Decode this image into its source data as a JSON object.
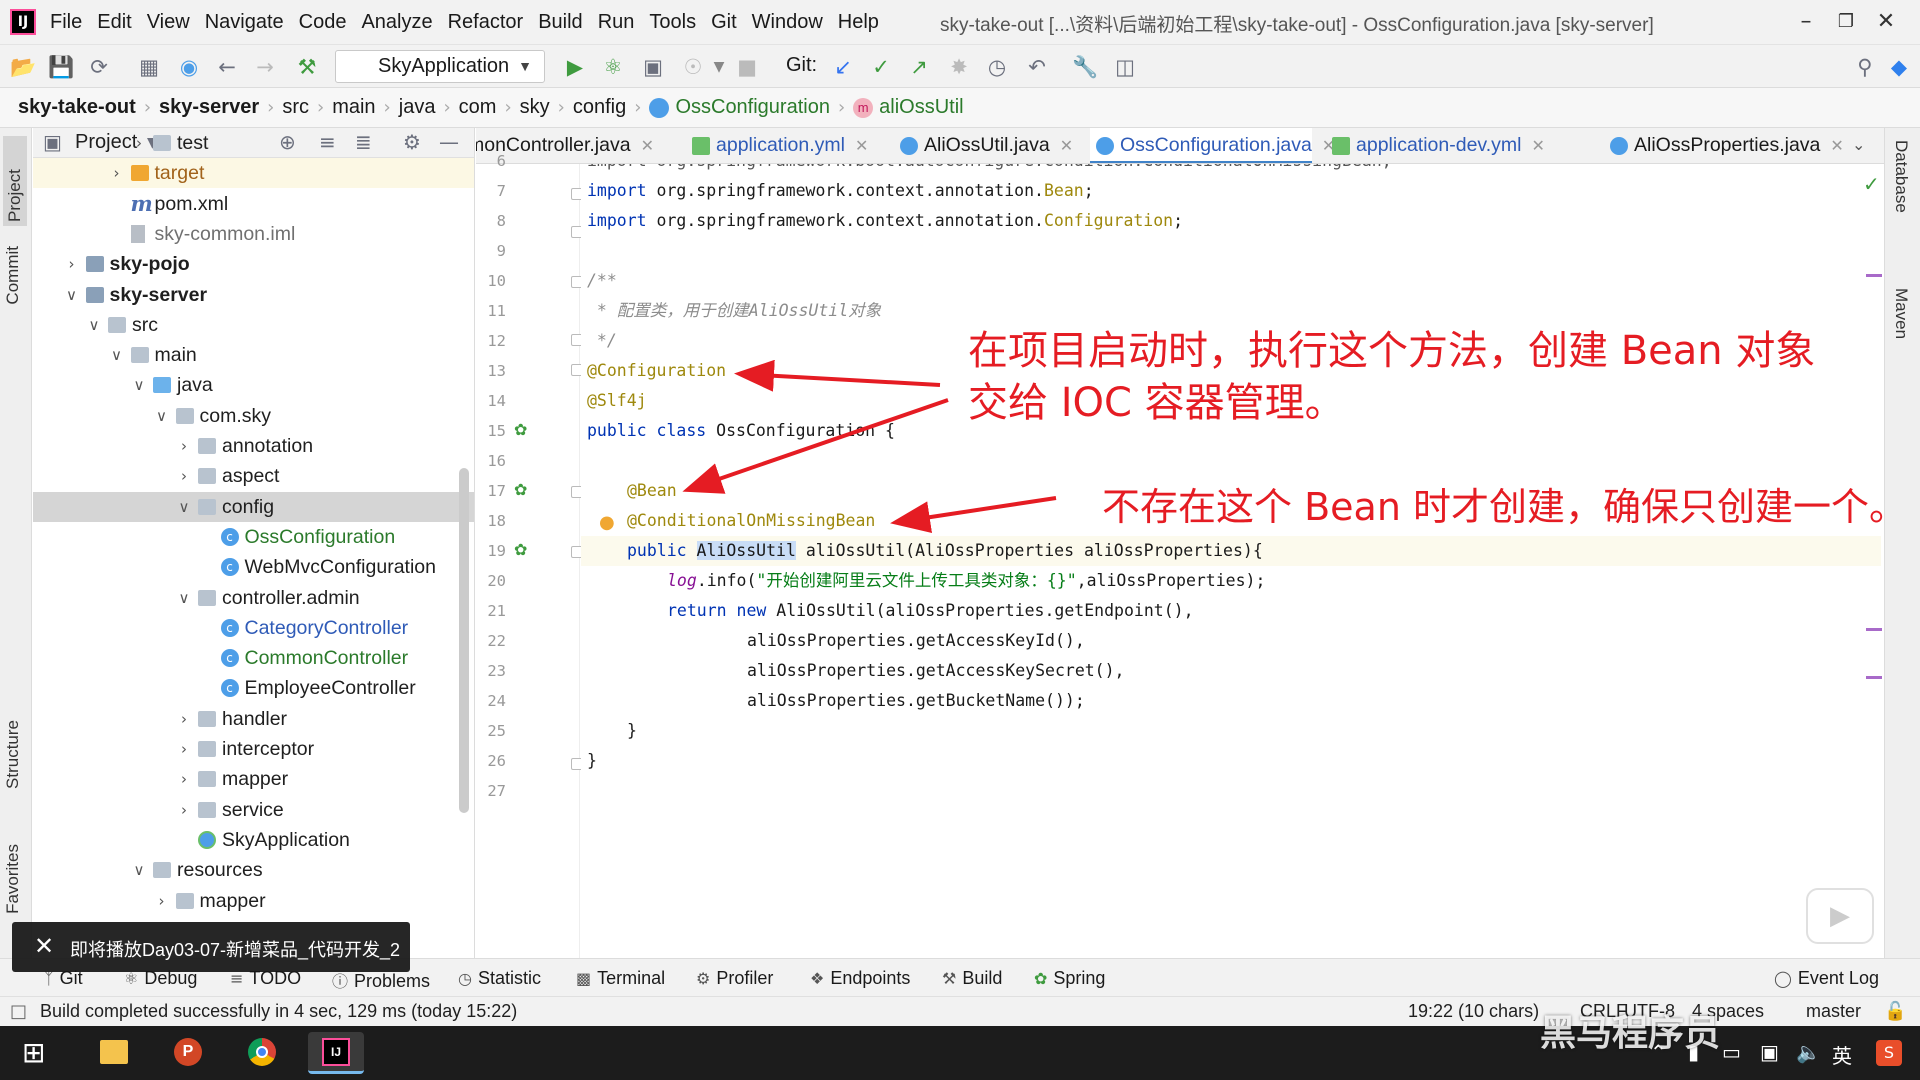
{
  "menubar": {
    "items": [
      "File",
      "Edit",
      "View",
      "Navigate",
      "Code",
      "Analyze",
      "Refactor",
      "Build",
      "Run",
      "Tools",
      "Git",
      "Window",
      "Help"
    ],
    "window_title": "sky-take-out [...\\资料\\后端初始工程\\sky-take-out] - OssConfiguration.java [sky-server]",
    "logo_text": "IJ"
  },
  "toolbar": {
    "run_config": "SkyApplication",
    "git_label": "Git:"
  },
  "breadcrumb": [
    "sky-take-out",
    "sky-server",
    "src",
    "main",
    "java",
    "com",
    "sky",
    "config",
    "OssConfiguration",
    "aliOssUtil"
  ],
  "left_strip": {
    "tabs": [
      "Project",
      "Commit",
      "Structure",
      "Favorites"
    ]
  },
  "project_panel": {
    "title": "Project",
    "tree": [
      {
        "label": "test",
        "indent": 4,
        "arrow": "right",
        "icon": "folder"
      },
      {
        "label": "target",
        "indent": 3,
        "arrow": "right",
        "icon": "folder-orange",
        "style": "orange",
        "highlight": true
      },
      {
        "label": "pom.xml",
        "indent": 3,
        "arrow": "",
        "icon": "maven"
      },
      {
        "label": "sky-common.iml",
        "indent": 3,
        "arrow": "",
        "icon": "iml",
        "style": "gray"
      },
      {
        "label": "sky-pojo",
        "indent": 1,
        "arrow": "right",
        "icon": "module",
        "style": "bold"
      },
      {
        "label": "sky-server",
        "indent": 1,
        "arrow": "down",
        "icon": "module",
        "style": "bold"
      },
      {
        "label": "src",
        "indent": 2,
        "arrow": "down",
        "icon": "folder"
      },
      {
        "label": "main",
        "indent": 3,
        "arrow": "down",
        "icon": "folder"
      },
      {
        "label": "java",
        "indent": 4,
        "arrow": "down",
        "icon": "folder-blue"
      },
      {
        "label": "com.sky",
        "indent": 5,
        "arrow": "down",
        "icon": "folder"
      },
      {
        "label": "annotation",
        "indent": 6,
        "arrow": "right",
        "icon": "folder"
      },
      {
        "label": "aspect",
        "indent": 6,
        "arrow": "right",
        "icon": "folder"
      },
      {
        "label": "config",
        "indent": 6,
        "arrow": "down",
        "icon": "folder",
        "selected": true
      },
      {
        "label": "OssConfiguration",
        "indent": 7,
        "arrow": "",
        "icon": "class",
        "style": "green"
      },
      {
        "label": "WebMvcConfiguration",
        "indent": 7,
        "arrow": "",
        "icon": "class"
      },
      {
        "label": "controller.admin",
        "indent": 6,
        "arrow": "down",
        "icon": "folder"
      },
      {
        "label": "CategoryController",
        "indent": 7,
        "arrow": "",
        "icon": "class",
        "style": "blue"
      },
      {
        "label": "CommonController",
        "indent": 7,
        "arrow": "",
        "icon": "class",
        "style": "green"
      },
      {
        "label": "EmployeeController",
        "indent": 7,
        "arrow": "",
        "icon": "class"
      },
      {
        "label": "handler",
        "indent": 6,
        "arrow": "right",
        "icon": "folder"
      },
      {
        "label": "interceptor",
        "indent": 6,
        "arrow": "right",
        "icon": "folder"
      },
      {
        "label": "mapper",
        "indent": 6,
        "arrow": "right",
        "icon": "folder"
      },
      {
        "label": "service",
        "indent": 6,
        "arrow": "right",
        "icon": "folder"
      },
      {
        "label": "SkyApplication",
        "indent": 6,
        "arrow": "",
        "icon": "app-class"
      },
      {
        "label": "resources",
        "indent": 4,
        "arrow": "down",
        "icon": "folder"
      },
      {
        "label": "mapper",
        "indent": 5,
        "arrow": "right",
        "icon": "folder"
      }
    ]
  },
  "editor_tabs": [
    {
      "label": "monController.java",
      "icon": "class",
      "link": false
    },
    {
      "label": "application.yml",
      "icon": "yml",
      "link": true
    },
    {
      "label": "AliOssUtil.java",
      "icon": "class",
      "link": false
    },
    {
      "label": "OssConfiguration.java",
      "icon": "class",
      "link": true,
      "active": true
    },
    {
      "label": "application-dev.yml",
      "icon": "yml",
      "link": true
    },
    {
      "label": "AliOssProperties.java",
      "icon": "class",
      "link": false
    }
  ],
  "editor": {
    "line_numbers": [
      "6",
      "7",
      "8",
      "9",
      "10",
      "11",
      "12",
      "13",
      "14",
      "15",
      "16",
      "17",
      "18",
      "19",
      "20",
      "21",
      "22",
      "23",
      "24",
      "25",
      "26",
      "27"
    ],
    "code": {
      "l6": "import org.springframework.boot.autoconfigure.condition.ConditionalOnMissingBean;",
      "l7_kw": "import ",
      "l7_pkg": "org.springframework.context.annotation.",
      "l7_cls": "Bean",
      "l7_end": ";",
      "l8_kw": "import ",
      "l8_pkg": "org.springframework.context.annotation.",
      "l8_cls": "Configuration",
      "l8_end": ";",
      "l10": "/**",
      "l11": " * 配置类，用于创建AliOssUtil对象",
      "l12": " */",
      "l13": "@Configuration",
      "l14": "@Slf4j",
      "l15_kw": "public class ",
      "l15_name": "OssConfiguration {",
      "l17": "@Bean",
      "l18": "@ConditionalOnMissingBean",
      "l19_kw": "public ",
      "l19_sel": "AliOssUtil",
      "l19_rest": " aliOssUtil(AliOssProperties aliOssProperties){",
      "l20_log": "log",
      "l20_mid": ".info(",
      "l20_str": "\"开始创建阿里云文件上传工具类对象：{}\"",
      "l20_end": ",aliOssProperties);",
      "l21_kw": "return new ",
      "l21_rest": "AliOssUtil(aliOssProperties.getEndpoint(),",
      "l22": "aliOssProperties.getAccessKeyId(),",
      "l23": "aliOssProperties.getAccessKeySecret(),",
      "l24": "aliOssProperties.getBucketName());",
      "l25": "}",
      "l26": "}"
    }
  },
  "annotations": {
    "note1_line1": "在项目启动时，执行这个方法，创建 Bean 对象",
    "note1_line2": "交给 IOC 容器管理。",
    "note2": "不存在这个 Bean 时才创建，确保只创建一个。"
  },
  "right_strip": {
    "tabs": [
      "Database",
      "Maven"
    ]
  },
  "bottom_tools": [
    "Git",
    "Debug",
    "TODO",
    "Problems",
    "Statistic",
    "Terminal",
    "Profiler",
    "Endpoints",
    "Build",
    "Spring",
    "Event Log"
  ],
  "statusbar": {
    "message": "Build completed successfully in 4 sec, 129 ms (today 15:22)",
    "position": "19:22 (10 chars)",
    "line_sep": "CRLF",
    "encoding": "UTF-8",
    "indent": "4 spaces",
    "branch": "master"
  },
  "toast": {
    "text": "即将播放Day03-07-新增菜品_代码开发_2"
  },
  "taskbar": {
    "ime": "英",
    "watermark": "黑马程序员"
  },
  "colors": {
    "annotation_red": "#e51c23",
    "accent_blue": "#4083c9",
    "keyword": "#0033b3",
    "annotation_yellow": "#9e880d"
  }
}
